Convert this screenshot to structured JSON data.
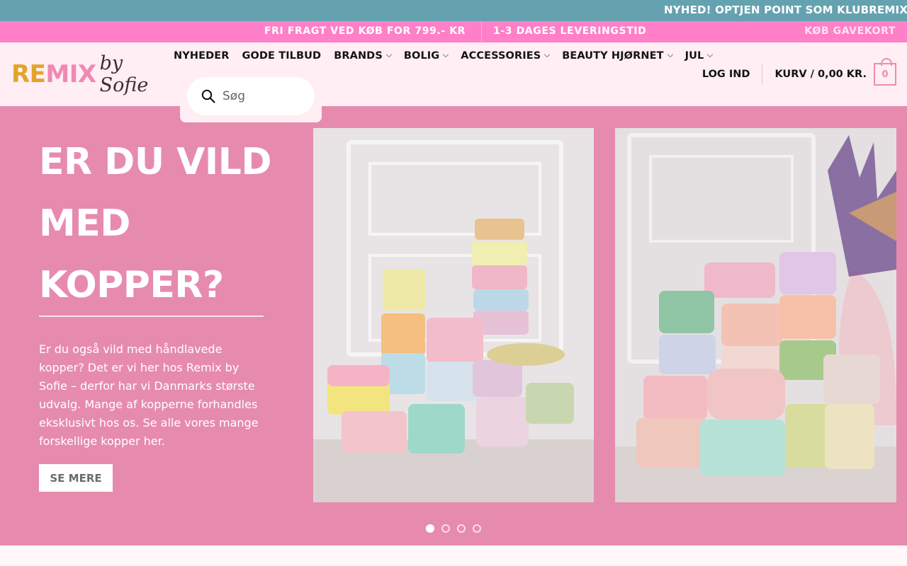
{
  "ticker": {
    "text": "NYHED! OPTJEN POINT SOM KLUBREMIX MEDL"
  },
  "promo_bar": {
    "free_shipping": "FRI FRAGT VED KØB FOR 799.- KR",
    "delivery": "1-3 DAGES LEVERINGSTID",
    "gift_card": "KØB GAVEKORT"
  },
  "logo": {
    "part1": "RE",
    "part2": "MIX",
    "part3": "by Sofie"
  },
  "nav": {
    "items": [
      {
        "label": "NYHEDER",
        "has_dropdown": false
      },
      {
        "label": "GODE TILBUD",
        "has_dropdown": false
      },
      {
        "label": "BRANDS",
        "has_dropdown": true
      },
      {
        "label": "BOLIG",
        "has_dropdown": true
      },
      {
        "label": "ACCESSORIES",
        "has_dropdown": true
      },
      {
        "label": "BEAUTY HJØRNET",
        "has_dropdown": true
      },
      {
        "label": "JUL",
        "has_dropdown": true
      }
    ]
  },
  "search": {
    "placeholder": "Søg",
    "value": "",
    "icon": "search-icon"
  },
  "account": {
    "login_label": "LOG IND"
  },
  "cart": {
    "label": "KURV / 0,00 KR.",
    "count": "0"
  },
  "hero": {
    "title_line1": "ER DU VILD",
    "title_line2": "MED",
    "title_line3": "KOPPER?",
    "body": "Er du også vild med håndlavede kopper? Det er vi her hos Remix by Sofie – derfor har vi Danmarks største udvalg. Mange af kopperne forhandles eksklusivt hos os.  Se alle vores mange forskellige kopper her.",
    "button_label": "SE MERE"
  },
  "slider": {
    "total_slides": 4,
    "active_slide": 1
  },
  "colors": {
    "ticker_bg": "#64a2b0",
    "promo_bg": "#ff80c8",
    "header_bg": "#ffeef3",
    "hero_bg": "#e68bae",
    "accent_pink": "#ee8db2",
    "logo_gold": "#e2a52a"
  }
}
